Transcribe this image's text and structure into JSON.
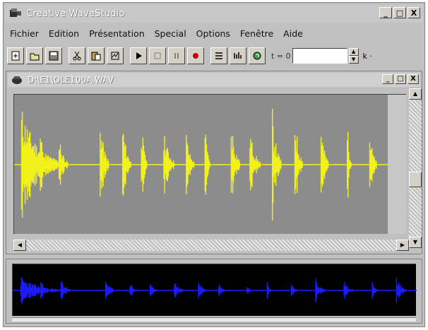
{
  "window": {
    "title": "Creative WaveStudio",
    "min_glyph": "_",
    "max_glyph": "□",
    "close_glyph": "X"
  },
  "menu": [
    "Fichier",
    "Edition",
    "Présentation",
    "Special",
    "Options",
    "Fenêtre",
    "Aide"
  ],
  "toolbar": {
    "buttons": [
      "new-icon",
      "open-icon",
      "save-icon",
      "cut-icon",
      "paste-icon",
      "paste-mix-icon",
      "play-icon",
      "stop-icon",
      "pause-icon",
      "record-icon",
      "list-icon",
      "effects-icon",
      "reload-icon"
    ],
    "position_label": "t = 0",
    "position_value": "",
    "tail_label": "k ·"
  },
  "document": {
    "title": "D:\\E1\\OLE100A.WAV",
    "min_glyph": "_",
    "max_glyph": "□",
    "close_glyph": "X"
  },
  "colors": {
    "waveform": "#f2f21a",
    "waveform_bg": "#8c8c8c",
    "overview_wave": "#1a1aff",
    "overview_bg": "#000000"
  },
  "waveform_bursts": [
    0.02,
    0.07,
    0.12,
    0.23,
    0.29,
    0.34,
    0.4,
    0.46,
    0.51,
    0.58,
    0.63,
    0.69,
    0.75,
    0.82,
    0.89,
    0.95
  ]
}
